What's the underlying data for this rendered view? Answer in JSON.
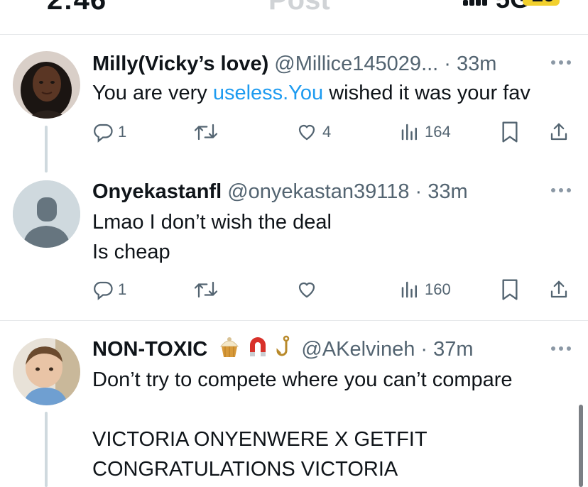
{
  "status_bar": {
    "time": "2:46",
    "title_ghost": "Post",
    "network": "5G",
    "battery": "10"
  },
  "tweets": [
    {
      "name": "Milly(Vicky’s love)",
      "handle": "@Millice145029...",
      "time": "33m",
      "text_before": "You are very ",
      "text_link": "useless.You",
      "text_after": " wished it was your fav",
      "replies": "1",
      "likes": "4",
      "views": "164"
    },
    {
      "name": "Onyekastanfl",
      "handle": "@onyekastan39118",
      "time": "33m",
      "lines": [
        "Lmao I don’t wish the deal",
        "Is cheap"
      ],
      "replies": "1",
      "views": "160"
    },
    {
      "name": "NON-TOXIC",
      "emojis": [
        "cupcake-emoji",
        "magnet-emoji",
        "hook-emoji"
      ],
      "handle": "@AKelvineh",
      "time": "37m",
      "lines": [
        "Don’t try to compete where you can’t compare",
        "",
        "VICTORIA ONYENWERE X GETFIT",
        "CONGRATULATIONS VICTORIA"
      ]
    }
  ],
  "colors": {
    "link": "#1d9bf0",
    "secondary_text": "#536471",
    "thread_line": "#cfd9de"
  }
}
